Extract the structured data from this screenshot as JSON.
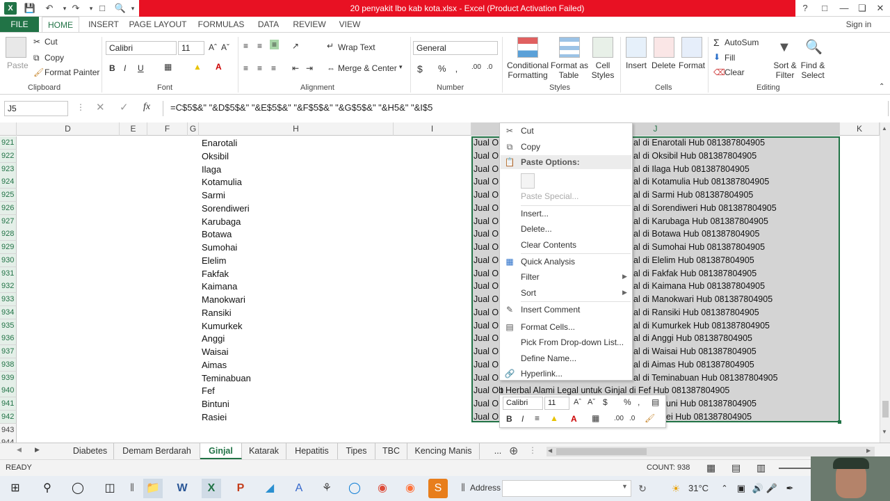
{
  "title": "20 penyakit lbo kab kota.xlsx - Excel (Product Activation Failed)",
  "window_controls": {
    "help": "?",
    "restore_ribbon": "□",
    "minimize": "—",
    "maximize": "❏",
    "close": "✕"
  },
  "menu": {
    "file": "FILE",
    "tabs": [
      "HOME",
      "INSERT",
      "PAGE LAYOUT",
      "FORMULAS",
      "DATA",
      "REVIEW",
      "VIEW"
    ],
    "sign_in": "Sign in"
  },
  "ribbon": {
    "clipboard": {
      "paste": "Paste",
      "cut": "Cut",
      "copy": "Copy",
      "format_painter": "Format Painter",
      "group": "Clipboard"
    },
    "font": {
      "name": "Calibri",
      "size": "11",
      "group": "Font"
    },
    "alignment": {
      "wrap": "Wrap Text",
      "merge": "Merge & Center",
      "group": "Alignment"
    },
    "number": {
      "format": "General",
      "group": "Number"
    },
    "styles": {
      "conditional_1": "Conditional",
      "conditional_2": "Formatting",
      "format_as_1": "Format as",
      "format_as_2": "Table",
      "cell_1": "Cell",
      "cell_2": "Styles",
      "group": "Styles"
    },
    "cells": {
      "insert": "Insert",
      "delete": "Delete",
      "format": "Format",
      "group": "Cells"
    },
    "editing": {
      "autosum": "AutoSum",
      "fill": "Fill",
      "clear": "Clear",
      "sort_1": "Sort &",
      "sort_2": "Filter",
      "find_1": "Find &",
      "find_2": "Select",
      "group": "Editing"
    }
  },
  "formula_bar": {
    "name_box": "J5",
    "formula": "=C$5$&\" \"&D$5$&\" \"&E$5$&\" \"&F$5$&\" \"&G$5$&\" \"&H5&\" \"&I$5"
  },
  "columns": [
    "D",
    "E",
    "F",
    "G",
    "H",
    "I",
    "J",
    "K"
  ],
  "rows": [
    {
      "num": "921",
      "h": "Enarotali",
      "j_left": "Jual Ob",
      "j_right": "al di Enarotali Hub 081387804905"
    },
    {
      "num": "922",
      "h": "Oksibil",
      "j_left": "Jual Ob",
      "j_right": "al di Oksibil Hub 081387804905"
    },
    {
      "num": "923",
      "h": "Ilaga",
      "j_left": "Jual Ob",
      "j_right": "al di Ilaga Hub 081387804905"
    },
    {
      "num": "924",
      "h": "Kotamulia",
      "j_left": "Jual Ob",
      "j_right": "al di Kotamulia Hub 081387804905"
    },
    {
      "num": "925",
      "h": "Sarmi",
      "j_left": "Jual Ob",
      "j_right": "al di Sarmi Hub 081387804905"
    },
    {
      "num": "926",
      "h": "Sorendiweri",
      "j_left": "Jual Ob",
      "j_right": "al di Sorendiweri Hub 081387804905"
    },
    {
      "num": "927",
      "h": "Karubaga",
      "j_left": "Jual Ob",
      "j_right": "al di Karubaga Hub 081387804905"
    },
    {
      "num": "928",
      "h": "Botawa",
      "j_left": "Jual Ob",
      "j_right": "al di Botawa Hub 081387804905"
    },
    {
      "num": "929",
      "h": "Sumohai",
      "j_left": "Jual Ob",
      "j_right": "al di Sumohai Hub 081387804905"
    },
    {
      "num": "930",
      "h": "Elelim",
      "j_left": "Jual Ob",
      "j_right": "al di Elelim Hub 081387804905"
    },
    {
      "num": "931",
      "h": "Fakfak",
      "j_left": "Jual Ob",
      "j_right": "al di Fakfak Hub 081387804905"
    },
    {
      "num": "932",
      "h": "Kaimana",
      "j_left": "Jual Ob",
      "j_right": "al di Kaimana Hub 081387804905"
    },
    {
      "num": "933",
      "h": "Manokwari",
      "j_left": "Jual Ob",
      "j_right": "al di Manokwari Hub 081387804905"
    },
    {
      "num": "934",
      "h": "Ransiki",
      "j_left": "Jual Ob",
      "j_right": "al di Ransiki Hub 081387804905"
    },
    {
      "num": "935",
      "h": "Kumurkek",
      "j_left": "Jual Ob",
      "j_right": "al di Kumurkek Hub 081387804905"
    },
    {
      "num": "936",
      "h": "Anggi",
      "j_left": "Jual Ob",
      "j_right": "al di Anggi Hub 081387804905"
    },
    {
      "num": "937",
      "h": "Waisai",
      "j_left": "Jual Ob",
      "j_right": "al di Waisai Hub 081387804905"
    },
    {
      "num": "938",
      "h": "Aimas",
      "j_left": "Jual Ob",
      "j_right": "al di Aimas Hub 081387804905"
    },
    {
      "num": "939",
      "h": "Teminabuan",
      "j_left": "Jual Ob",
      "j_right": "al di Teminabuan Hub 081387804905"
    },
    {
      "num": "940",
      "h": "Fef",
      "j_left": "Jual Ob",
      "j_right": "t Herbal Alami Legal untuk Ginjal di Fef Hub 081387804905"
    },
    {
      "num": "941",
      "h": "Bintuni",
      "j_left": "Jual Ob",
      "j_right": "uni Hub 081387804905"
    },
    {
      "num": "942",
      "h": "Rasiei",
      "j_left": "Jual Ob",
      "j_right": "ei Hub 081387804905"
    },
    {
      "num": "943",
      "h": "",
      "j_left": "",
      "j_right": ""
    },
    {
      "num": "944",
      "h": "",
      "j_left": "",
      "j_right": ""
    }
  ],
  "context_menu": {
    "cut": "Cut",
    "copy": "Copy",
    "paste_options": "Paste Options:",
    "paste_special": "Paste Special...",
    "insert": "Insert...",
    "delete": "Delete...",
    "clear_contents": "Clear Contents",
    "quick_analysis": "Quick Analysis",
    "filter": "Filter",
    "sort": "Sort",
    "insert_comment": "Insert Comment",
    "format_cells": "Format Cells...",
    "pick_list": "Pick From Drop-down List...",
    "define_name": "Define Name...",
    "hyperlink": "Hyperlink..."
  },
  "mini_toolbar": {
    "font": "Calibri",
    "size": "11",
    "bold": "B",
    "italic": "I",
    "font_color": "A",
    "currency": "$",
    "percent": "%",
    "comma": ","
  },
  "sheet_tabs": [
    "Diabetes",
    "Demam Berdarah",
    "Ginjal",
    "Katarak",
    "Hepatitis",
    "Tipes",
    "TBC",
    "Kencing Manis"
  ],
  "sheet_more": "...",
  "status": {
    "ready": "READY",
    "count": "COUNT: 938"
  },
  "taskbar": {
    "address": "Address",
    "temp": "31°C"
  }
}
